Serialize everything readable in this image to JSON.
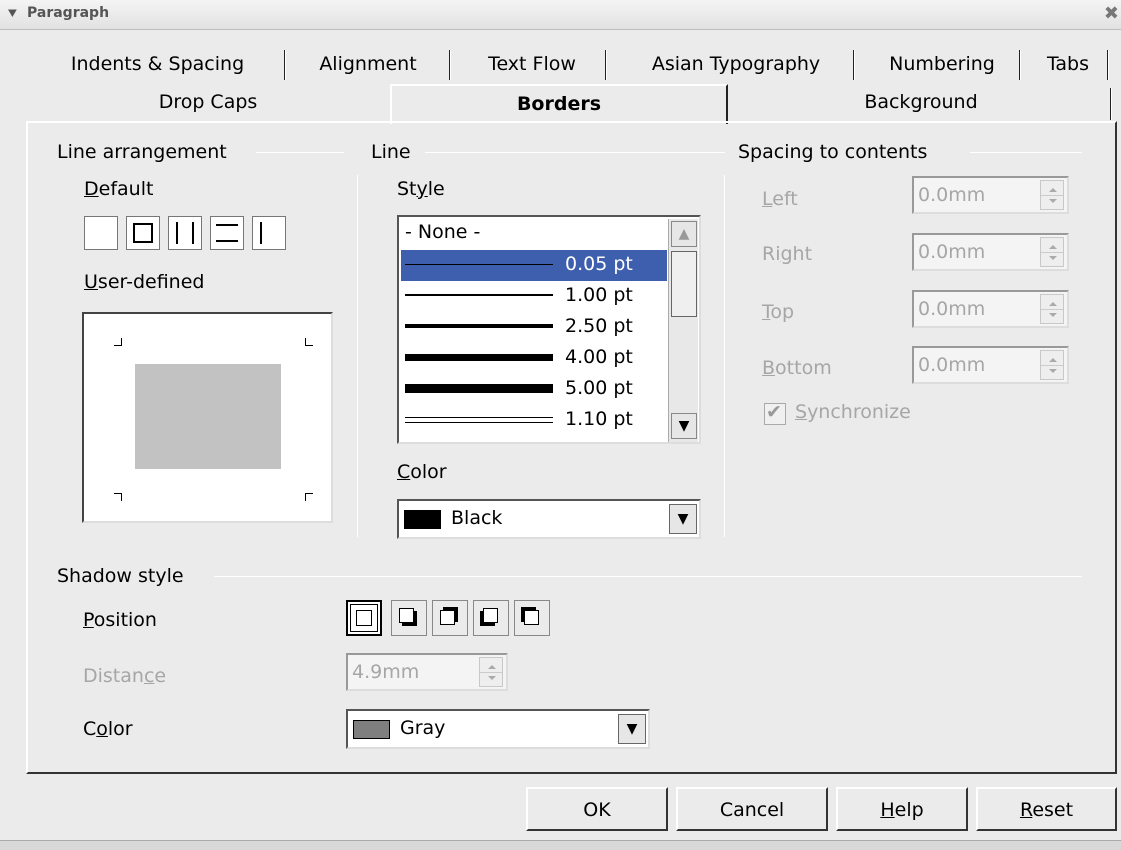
{
  "window": {
    "title": "Paragraph",
    "menu_icon": "chevron-down-icon",
    "close_icon": "close-icon"
  },
  "tabs_row1": [
    "Indents & Spacing",
    "Alignment",
    "Text Flow",
    "Asian Typography",
    "Numbering",
    "Tabs"
  ],
  "tabs_row2": [
    "Drop Caps",
    "Borders",
    "Background"
  ],
  "active_tab": "Borders",
  "line_arrangement": {
    "title": "Line arrangement",
    "default_label_u": "D",
    "default_label_rest": "efault",
    "presets": [
      "no-border-icon",
      "box-border-icon",
      "left-right-border-icon",
      "top-bottom-border-icon",
      "left-border-icon"
    ],
    "user_defined_u": "U",
    "user_defined_rest": "ser-defined"
  },
  "line": {
    "title": "Line",
    "style_label_pre": "St",
    "style_label_u": "y",
    "style_label_post": "le",
    "styles": [
      {
        "label": "- None -",
        "kind": "none"
      },
      {
        "label": "0.05 pt",
        "kind": "single",
        "selected": true
      },
      {
        "label": "1.00 pt",
        "kind": "single"
      },
      {
        "label": "2.50 pt",
        "kind": "single"
      },
      {
        "label": "4.00 pt",
        "kind": "single"
      },
      {
        "label": "5.00 pt",
        "kind": "single"
      },
      {
        "label": "1.10 pt",
        "kind": "double"
      }
    ],
    "color_label_u": "C",
    "color_label_rest": "olor",
    "color_value": "Black",
    "color_swatch": "#000000"
  },
  "spacing": {
    "title": "Spacing to contents",
    "fields": [
      {
        "pre": "",
        "u": "L",
        "post": "eft",
        "value": "0.0mm"
      },
      {
        "pre": "Ri",
        "u": "g",
        "post": "ht",
        "value": "0.0mm"
      },
      {
        "pre": "",
        "u": "T",
        "post": "op",
        "value": "0.0mm"
      },
      {
        "pre": "",
        "u": "B",
        "post": "ottom",
        "value": "0.0mm"
      }
    ],
    "synchronize_u": "S",
    "synchronize_rest": "ynchronize",
    "synchronize_checked": true
  },
  "shadow": {
    "title": "Shadow style",
    "position_u": "P",
    "position_rest": "osition",
    "positions": [
      "no-shadow-icon",
      "shadow-bottom-right-icon",
      "shadow-top-right-icon",
      "shadow-bottom-left-icon",
      "shadow-top-left-icon"
    ],
    "distance_pre": "Distan",
    "distance_u": "c",
    "distance_post": "e",
    "distance_value": "4.9mm",
    "color_pre": "C",
    "color_u": "o",
    "color_post": "lor",
    "color_value": "Gray",
    "color_swatch": "#7f7f7f"
  },
  "buttons": {
    "ok": "OK",
    "cancel": "Cancel",
    "help_u": "H",
    "help_rest": "elp",
    "reset_u": "R",
    "reset_rest": "eset"
  }
}
